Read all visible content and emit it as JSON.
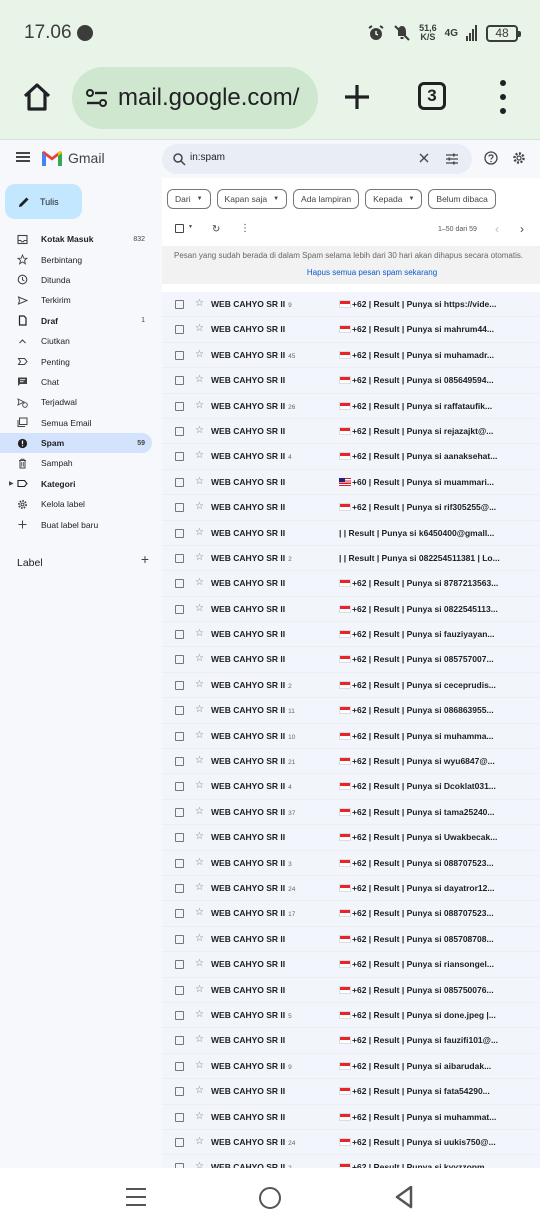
{
  "status_bar": {
    "time": "17.06",
    "net_speed_value": "51,6",
    "net_speed_unit": "K/S",
    "network": "4G",
    "battery": "48"
  },
  "browser": {
    "url": "mail.google.com/",
    "tab_count": "3"
  },
  "gmail": {
    "app_name": "Gmail",
    "search_value": "in:spam",
    "compose_label": "Tulis",
    "nav": [
      {
        "label": "Kotak Masuk",
        "count": "832",
        "icon": "inbox-icon",
        "bold": true
      },
      {
        "label": "Berbintang",
        "count": "",
        "icon": "star-icon",
        "bold": false
      },
      {
        "label": "Ditunda",
        "count": "",
        "icon": "clock-icon",
        "bold": false
      },
      {
        "label": "Terkirim",
        "count": "",
        "icon": "send-icon",
        "bold": false
      },
      {
        "label": "Draf",
        "count": "1",
        "icon": "draft-icon",
        "bold": true
      },
      {
        "label": "Ciutkan",
        "count": "",
        "icon": "chevron-up-icon",
        "bold": false
      },
      {
        "label": "Penting",
        "count": "",
        "icon": "important-icon",
        "bold": false
      },
      {
        "label": "Chat",
        "count": "",
        "icon": "chat-icon",
        "bold": false
      },
      {
        "label": "Terjadwal",
        "count": "",
        "icon": "scheduled-icon",
        "bold": false
      },
      {
        "label": "Semua Email",
        "count": "",
        "icon": "all-mail-icon",
        "bold": false
      },
      {
        "label": "Spam",
        "count": "59",
        "icon": "spam-icon",
        "bold": true,
        "active": true
      },
      {
        "label": "Sampah",
        "count": "",
        "icon": "trash-icon",
        "bold": false
      },
      {
        "label": "Kategori",
        "count": "",
        "icon": "label-icon",
        "bold": true
      },
      {
        "label": "Kelola label",
        "count": "",
        "icon": "settings-icon",
        "bold": false
      },
      {
        "label": "Buat label baru",
        "count": "",
        "icon": "plus-icon",
        "bold": false
      }
    ],
    "labels_title": "Label",
    "filters": [
      {
        "label": "Dari",
        "dropdown": true
      },
      {
        "label": "Kapan saja",
        "dropdown": true
      },
      {
        "label": "Ada lampiran",
        "dropdown": false
      },
      {
        "label": "Kepada",
        "dropdown": true
      },
      {
        "label": "Belum dibaca",
        "dropdown": false
      }
    ],
    "page_range": "1–50 dari 59",
    "notice": "Pesan yang sudah berada di dalam Spam selama lebih dari 30 hari akan dihapus secara otomatis.",
    "notice_link": "Hapus semua pesan spam sekarang",
    "sender": "WEB CAHYO SR II",
    "emails": [
      {
        "count": "9",
        "flag": "id",
        "subject": "+62 | Result | Punya si https://vide..."
      },
      {
        "count": "",
        "flag": "id",
        "subject": "+62 | Result | Punya si mahrum44..."
      },
      {
        "count": "45",
        "flag": "id",
        "subject": "+62 | Result | Punya si muhamadr..."
      },
      {
        "count": "",
        "flag": "id",
        "subject": "+62 | Result | Punya si 085649594..."
      },
      {
        "count": "26",
        "flag": "id",
        "subject": "+62 | Result | Punya si raffataufik..."
      },
      {
        "count": "",
        "flag": "id",
        "subject": "+62 | Result | Punya si rejazajkt@..."
      },
      {
        "count": "4",
        "flag": "id",
        "subject": "+62 | Result | Punya si aanaksehat..."
      },
      {
        "count": "",
        "flag": "my",
        "subject": "+60 | Result | Punya si muammari..."
      },
      {
        "count": "",
        "flag": "id",
        "subject": "+62 | Result | Punya si rif305255@..."
      },
      {
        "count": "",
        "flag": "",
        "subject": "| | Result | Punya si k6450400@gmall..."
      },
      {
        "count": "2",
        "flag": "",
        "subject": "| | Result | Punya si 082254511381 | Lo..."
      },
      {
        "count": "",
        "flag": "id",
        "subject": "+62 | Result | Punya si 8787213563..."
      },
      {
        "count": "",
        "flag": "id",
        "subject": "+62 | Result | Punya si 0822545113..."
      },
      {
        "count": "",
        "flag": "id",
        "subject": "+62 | Result | Punya si fauziyayan..."
      },
      {
        "count": "",
        "flag": "id",
        "subject": "+62 | Result | Punya si 085757007..."
      },
      {
        "count": "2",
        "flag": "id",
        "subject": "+62 | Result | Punya si ceceprudis..."
      },
      {
        "count": "11",
        "flag": "id",
        "subject": "+62 | Result | Punya si 086863955..."
      },
      {
        "count": "10",
        "flag": "id",
        "subject": "+62 | Result | Punya si muhamma..."
      },
      {
        "count": "21",
        "flag": "id",
        "subject": "+62 | Result | Punya si wyu6847@..."
      },
      {
        "count": "4",
        "flag": "id",
        "subject": "+62 | Result | Punya si Dcoklat031..."
      },
      {
        "count": "37",
        "flag": "id",
        "subject": "+62 | Result | Punya si tama25240..."
      },
      {
        "count": "",
        "flag": "id",
        "subject": "+62 | Result | Punya si Uwakbecak..."
      },
      {
        "count": "3",
        "flag": "id",
        "subject": "+62 | Result | Punya si 088707523..."
      },
      {
        "count": "24",
        "flag": "id",
        "subject": "+62 | Result | Punya si dayatror12..."
      },
      {
        "count": "17",
        "flag": "id",
        "subject": "+62 | Result | Punya si 088707523..."
      },
      {
        "count": "",
        "flag": "id",
        "subject": "+62 | Result | Punya si 085708708..."
      },
      {
        "count": "",
        "flag": "id",
        "subject": "+62 | Result | Punya si riansongel..."
      },
      {
        "count": "",
        "flag": "id",
        "subject": "+62 | Result | Punya si 085750076..."
      },
      {
        "count": "5",
        "flag": "id",
        "subject": "+62 | Result | Punya si done.jpeg |..."
      },
      {
        "count": "",
        "flag": "id",
        "subject": "+62 | Result | Punya si fauzifi101@..."
      },
      {
        "count": "9",
        "flag": "id",
        "subject": "+62 | Result | Punya si aibarudak..."
      },
      {
        "count": "",
        "flag": "id",
        "subject": "+62 | Result | Punya si fata54290..."
      },
      {
        "count": "",
        "flag": "id",
        "subject": "+62 | Result | Punya si muhammat..."
      },
      {
        "count": "24",
        "flag": "id",
        "subject": "+62 | Result | Punya si uukis750@..."
      },
      {
        "count": "2",
        "flag": "id",
        "subject": "+62 | Result | Punya si kyyzzopm..."
      }
    ]
  },
  "colors": {
    "browser_bg": "#e8f4e8",
    "url_pill": "#cfe6cf",
    "compose_bg": "#c2e7ff",
    "active_nav": "#d3e3fd",
    "link": "#0b57d0"
  }
}
